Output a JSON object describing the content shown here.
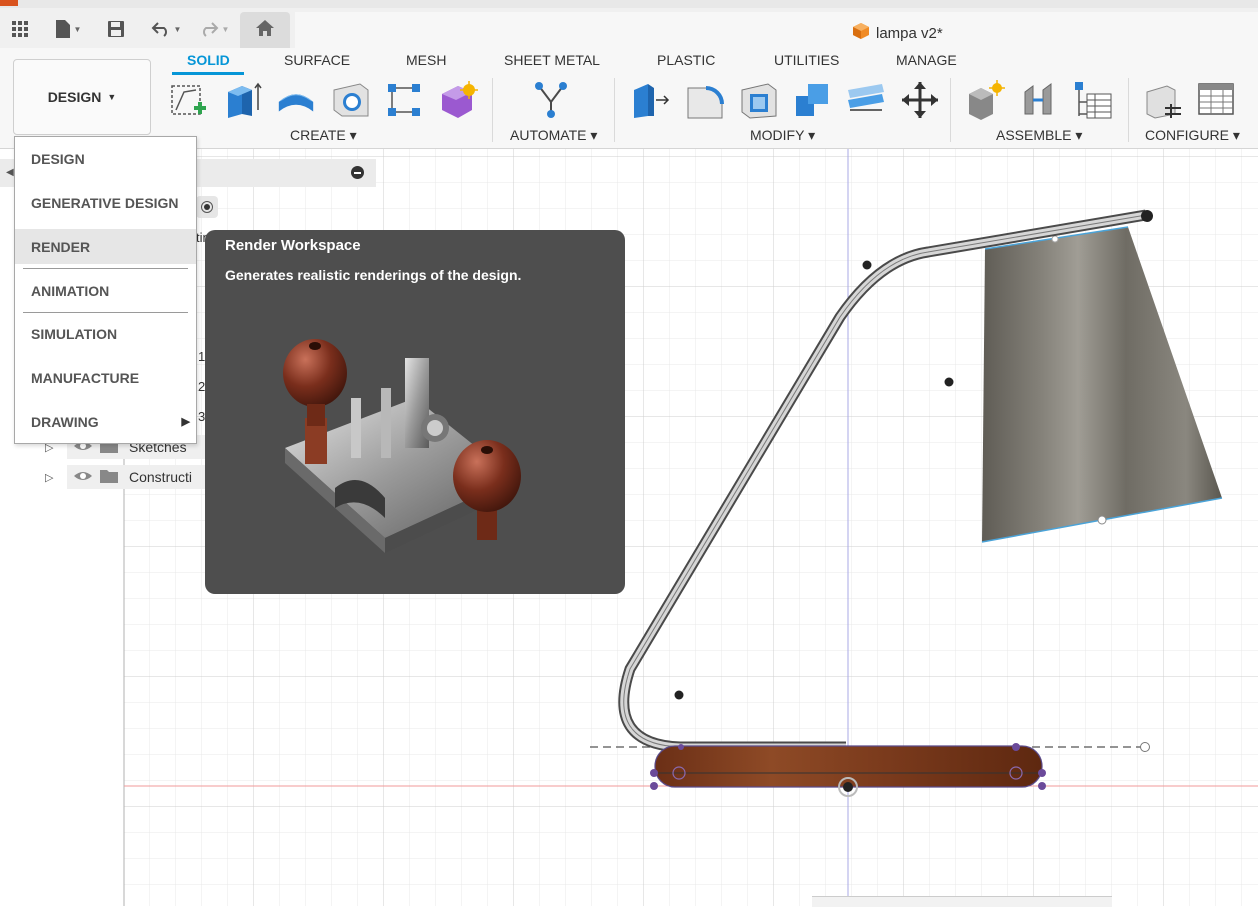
{
  "app": {
    "document_title": "lampa v2*"
  },
  "quick_access": {
    "icons": [
      "grid-icon",
      "file-icon",
      "save-icon",
      "undo-icon",
      "redo-icon",
      "home-icon"
    ]
  },
  "toolbar": {
    "workspace_button": "DESIGN",
    "tabs": [
      {
        "label": "SOLID",
        "active": true
      },
      {
        "label": "SURFACE",
        "active": false
      },
      {
        "label": "MESH",
        "active": false
      },
      {
        "label": "SHEET METAL",
        "active": false
      },
      {
        "label": "PLASTIC",
        "active": false
      },
      {
        "label": "UTILITIES",
        "active": false
      },
      {
        "label": "MANAGE",
        "active": false
      }
    ],
    "groups": [
      {
        "label": "CREATE ▾"
      },
      {
        "label": "AUTOMATE ▾"
      },
      {
        "label": "MODIFY ▾"
      },
      {
        "label": "ASSEMBLE ▾"
      },
      {
        "label": "CONFIGURE ▾"
      }
    ],
    "tool_icons": [
      "create-sketch-icon",
      "extrude-icon",
      "revolve-icon",
      "hole-icon",
      "pattern-icon",
      "form-icon",
      "automate-icon",
      "press-pull-icon",
      "fillet-icon",
      "shell-icon",
      "combine-icon",
      "offset-face-icon",
      "move-icon",
      "new-component-icon",
      "joint-icon",
      "bill-of-materials-icon",
      "configure-icon",
      "configure-table-icon"
    ]
  },
  "workspace_menu": {
    "items": [
      {
        "label": "DESIGN"
      },
      {
        "label": "GENERATIVE DESIGN"
      },
      {
        "label": "RENDER",
        "hover": true
      },
      {
        "label": "ANIMATION"
      },
      {
        "label": "SIMULATION"
      },
      {
        "label": "MANUFACTURE"
      },
      {
        "label": "DRAWING",
        "submenu": true
      }
    ]
  },
  "tooltip": {
    "title": "Render Workspace",
    "description": "Generates realistic renderings of the design."
  },
  "browser": {
    "partial_labels": [
      "tin",
      "1",
      "2",
      "3"
    ],
    "rows": [
      {
        "label": "Sketches"
      },
      {
        "label": "Constructi"
      }
    ]
  },
  "colors": {
    "accent": "#0696d7",
    "tooltip_bg": "#4e4e4e",
    "wood": "#7a3a1c",
    "shade": "#6e6b63"
  }
}
